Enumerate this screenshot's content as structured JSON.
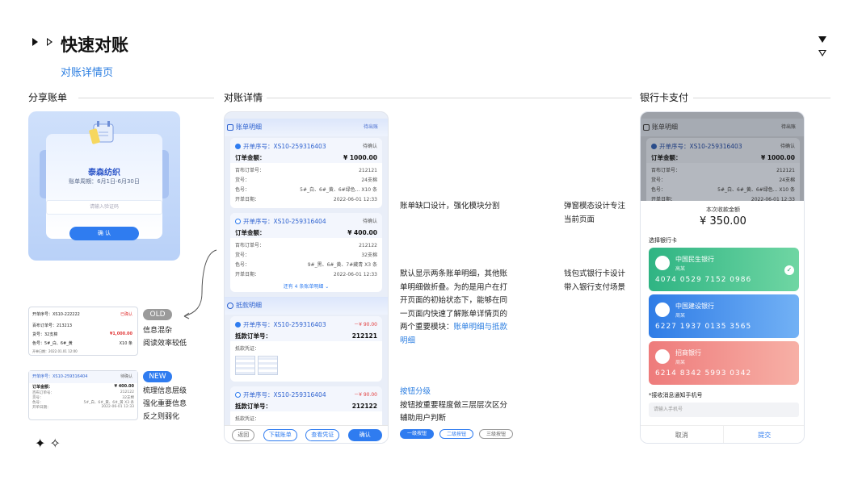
{
  "header": {
    "title": "快速对账",
    "subtitle": "对账详情页"
  },
  "sections": {
    "share": "分享账单",
    "detail": "对账详情",
    "bankpay": "银行卡支付"
  },
  "share_card": {
    "company": "泰森纺织",
    "period": "账单周期：6月1日-6月30日",
    "input_placeholder": "请输入验证码",
    "confirm": "确 认"
  },
  "old": {
    "tag": "OLD",
    "notes": [
      "信息混杂",
      "阅读效率较低"
    ],
    "line1": "开单序号：XS10-222222",
    "status": "已确认",
    "line2": "百布订单号：213213",
    "line3": "货号：32支棉",
    "amount": "¥1,000.00",
    "line4": "色号：5#_白、6#_黄",
    "count": "X10 条",
    "date": "开单日期：2022.01.01  12:00"
  },
  "new": {
    "tag": "NEW",
    "notes": [
      "梳理信息层级",
      "强化重要信息",
      "反之则弱化"
    ],
    "line1": "开单序号：XS10-259316404",
    "status": "待确认",
    "order_label": "订单金额：",
    "amount": "¥ 400.00",
    "rows": [
      [
        "百布订单号：",
        "212122"
      ],
      [
        "货号：",
        "32支棉"
      ],
      [
        "色号：",
        "5#_白、6#_黄、6#_黄  X3 条"
      ],
      [
        "开单日期：",
        "2022-06-01 12:33"
      ]
    ]
  },
  "detail": {
    "bills_title": "账单明细",
    "bills_status": "待出账",
    "bill1": {
      "sn": "开单序号：XS10-259316403",
      "status": "待确认",
      "amount_label": "订单金额：",
      "amount": "¥ 1000.00",
      "rows": [
        [
          "百布订单号：",
          "212121"
        ],
        [
          "货号：",
          "24支棉"
        ],
        [
          "色号：",
          "5#_白、6#_黄、6#绿色...  X10 条"
        ],
        [
          "开单日期：",
          "2022-06-01 12:33"
        ]
      ]
    },
    "bill2": {
      "sn": "开单序号：XS10-259316404",
      "status": "待确认",
      "amount_label": "订单金额：",
      "amount": "¥ 400.00",
      "rows": [
        [
          "百布订单号：",
          "212122"
        ],
        [
          "货号：",
          "32支棉"
        ],
        [
          "色号：",
          "9#_黑、6#_黄、7#藏青  X3 条"
        ],
        [
          "开单日期：",
          "2022-06-01 12:33"
        ]
      ]
    },
    "more": "还有 4  条账单明细 ⌄",
    "deduct_title": "抵款明细",
    "ded1": {
      "sn": "开单序号：XS10-259316403",
      "amount": "－¥ 90.00",
      "label": "抵款订单号：",
      "no": "212121",
      "voucher": "抵款凭证："
    },
    "ded2": {
      "sn": "开单序号：XS10-259316404",
      "amount": "－¥ 90.00",
      "label": "抵款订单号：",
      "no": "212122",
      "voucher": "抵款凭证："
    },
    "buttons": [
      "返回",
      "下载账单",
      "查看凭证",
      "确认"
    ]
  },
  "notes_mid": {
    "n1": "账单缺口设计，强化模块分割",
    "n2_lines": [
      "默认显示两条账单明细，其他账",
      "单明细做折叠。为的是用户在打",
      "开页面的初始状态下，能够在同",
      "一页面内快速了解账单详情页的"
    ],
    "n2_last": "两个重要模块：",
    "n2_blue": "账单明细与抵款",
    "n2_blue2": "明细",
    "n3_title": "按钮分级",
    "n3_lines": [
      "按钮按重要程度做三层层次区分",
      "辅助用户判断"
    ],
    "levels": [
      "一级按钮",
      "二级按钮",
      "三级按钮"
    ]
  },
  "notes_right": {
    "n1": [
      "弹窗模态设计专注",
      "当前页面"
    ],
    "n2": [
      "钱包式银行卡设计",
      "带入银行支付场景"
    ]
  },
  "pay": {
    "amount_label": "本次收款金额",
    "amount": "¥ 350.00",
    "select": "选择银行卡",
    "banks": [
      {
        "name": "中国民生银行",
        "sub": "高某",
        "num": "4074  0529  7152  0986"
      },
      {
        "name": "中国建设银行",
        "sub": "周某",
        "num": "6227  1937  0135  3565"
      },
      {
        "name": "招商银行",
        "sub": "周某",
        "num": "6214  8342  5993  0342"
      }
    ],
    "phone_label": "*接收消息通知手机号",
    "phone_placeholder": "请输入手机号",
    "cancel": "取消",
    "submit": "提交"
  }
}
